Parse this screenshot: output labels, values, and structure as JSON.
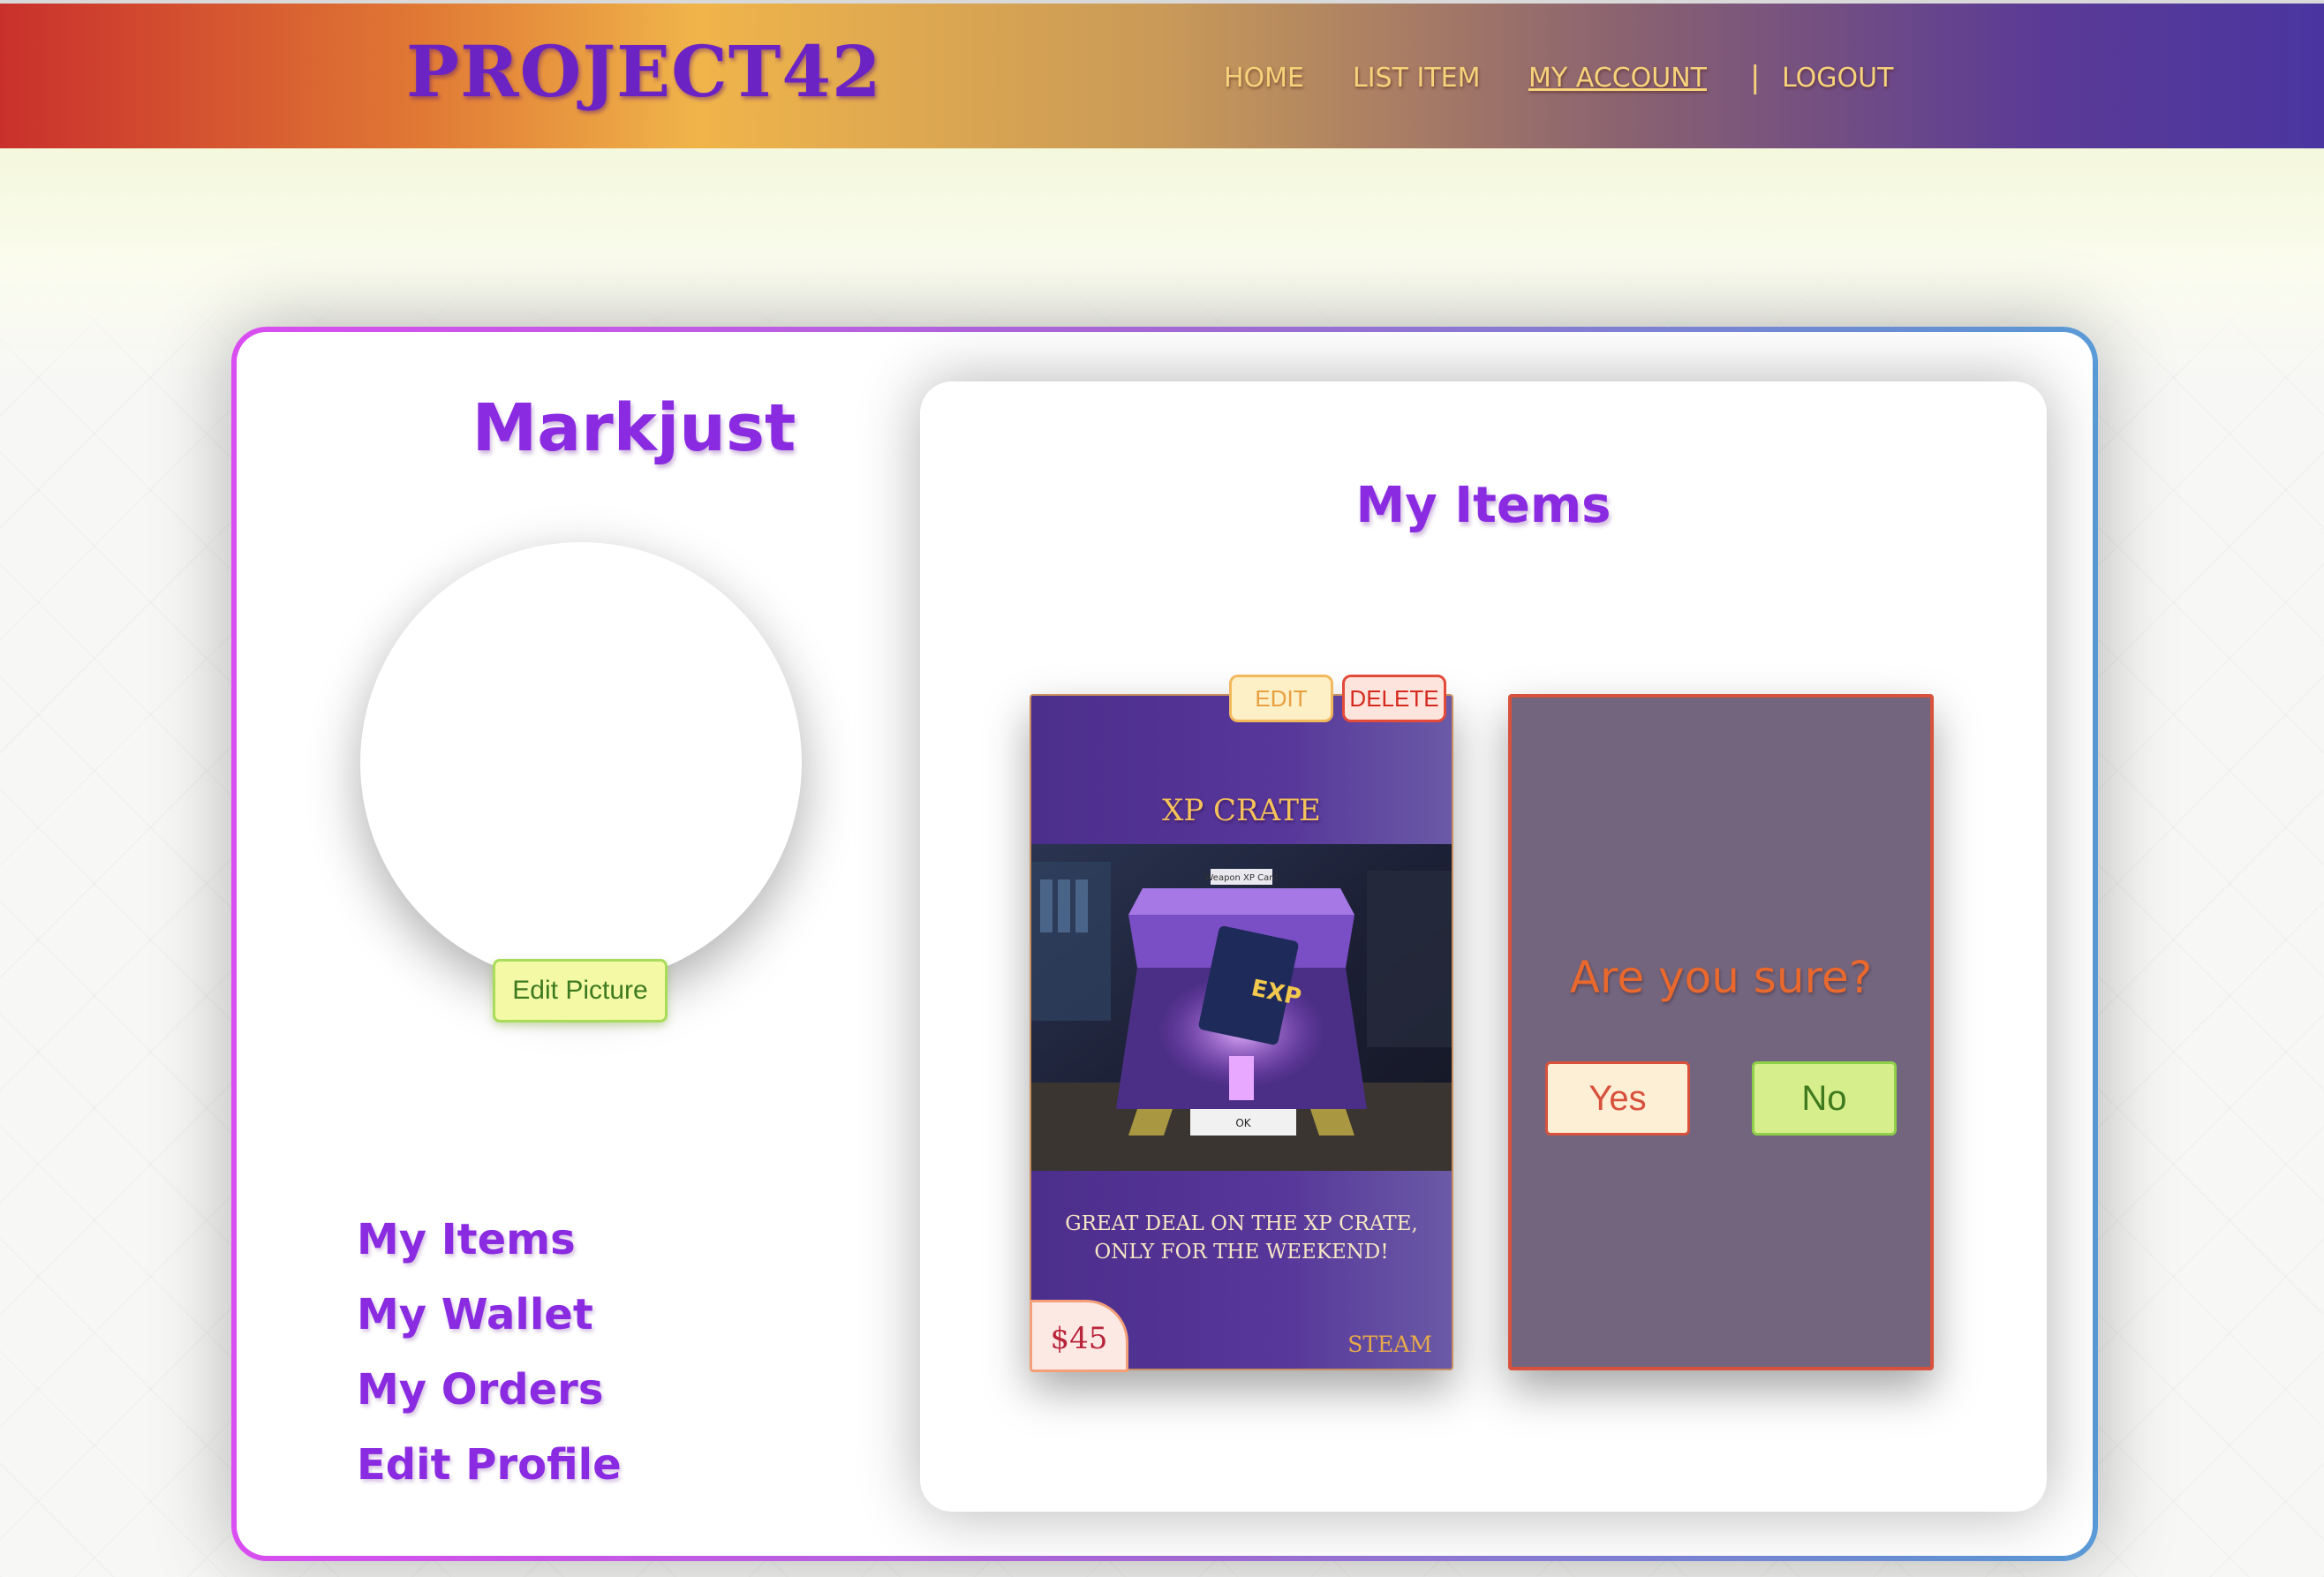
{
  "header": {
    "logo": "PROJECT42",
    "nav": {
      "home": "HOME",
      "list_item": "LIST ITEM",
      "my_account": "MY ACCOUNT",
      "separator": "|",
      "logout": "LOGOUT"
    },
    "active_nav": "my_account"
  },
  "profile": {
    "username": "Markjust",
    "edit_picture_label": "Edit Picture",
    "side_links": {
      "my_items": "My Items",
      "my_wallet": "My Wallet",
      "my_orders": "My Orders",
      "edit_profile": "Edit Profile"
    }
  },
  "items_panel": {
    "title": "My Items",
    "item": {
      "edit_label": "EDIT",
      "delete_label": "DELETE",
      "title": "XP CRATE",
      "image_overlay_label": "Weapon XP Card",
      "image_card_text": "EXP",
      "image_ok_label": "OK",
      "description": "Great deal on the XP crate, only for the weekend!",
      "price": "$45",
      "platform": "Steam"
    },
    "confirm": {
      "question": "Are you sure?",
      "yes_label": "Yes",
      "no_label": "No"
    }
  },
  "colors": {
    "accent_purple": "#8a2be2",
    "nav_text": "#f6d27a",
    "danger": "#d8513d",
    "success": "#8fcf4a"
  },
  "icons": {
    "image": "xp-crate-image"
  }
}
